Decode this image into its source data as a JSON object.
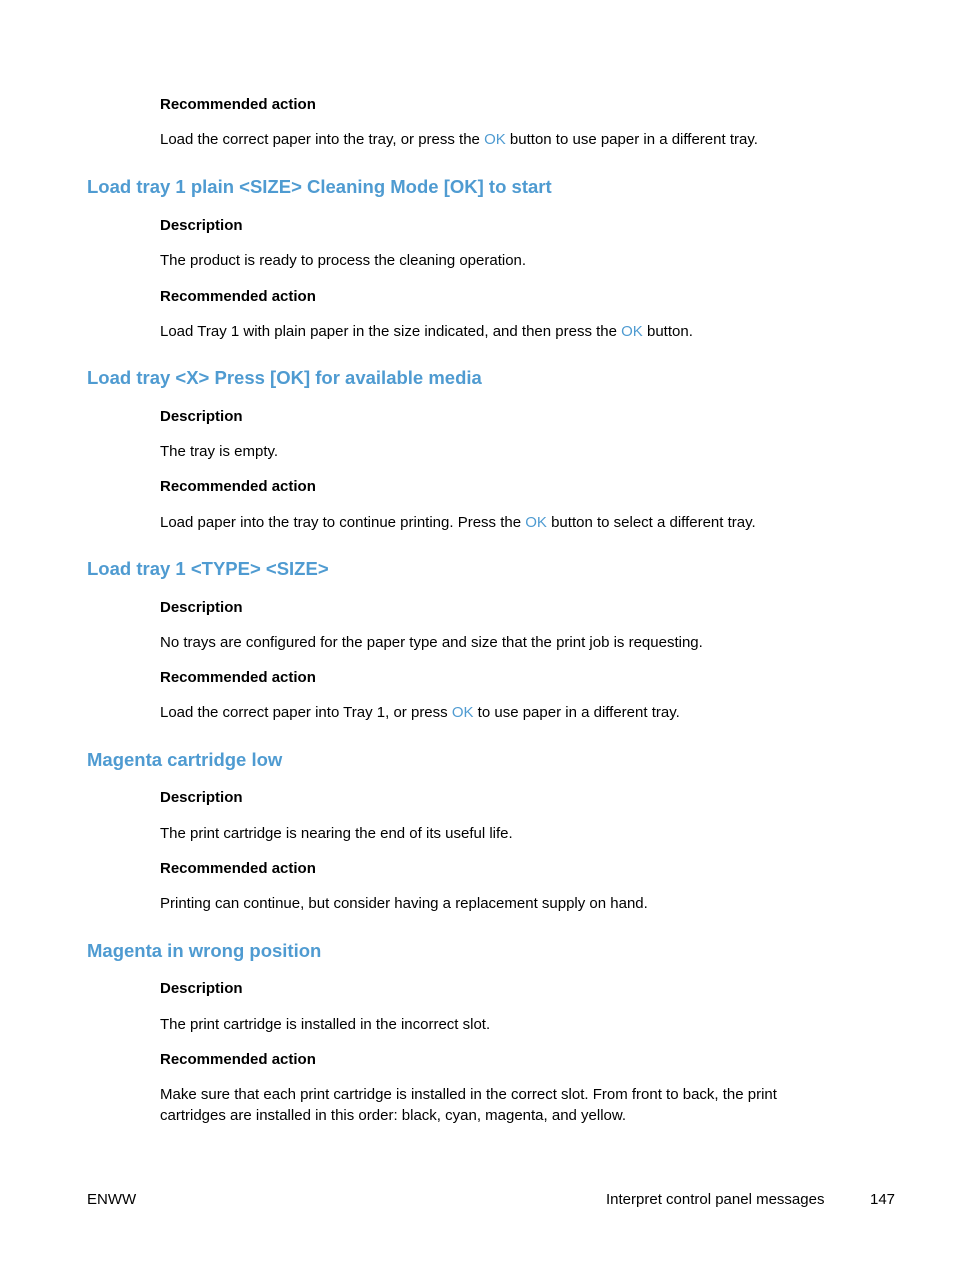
{
  "intro": {
    "label": "Recommended action",
    "text_before": "Load the correct paper into the tray, or press the ",
    "ok": "OK",
    "text_after": " button to use paper in a different tray."
  },
  "sections": [
    {
      "title": "Load tray 1 plain <SIZE> Cleaning Mode [OK] to start",
      "description_label": "Description",
      "description": "The product is ready to process the cleaning operation.",
      "action_label": "Recommended action",
      "action_before": "Load Tray 1 with plain paper in the size indicated, and then press the ",
      "action_ok": "OK",
      "action_after": " button."
    },
    {
      "title": "Load tray <X> Press [OK] for available media",
      "description_label": "Description",
      "description": "The tray is empty.",
      "action_label": "Recommended action",
      "action_before": "Load paper into the tray to continue printing. Press the ",
      "action_ok": "OK",
      "action_after": " button to select a different tray."
    },
    {
      "title": "Load tray 1 <TYPE> <SIZE>",
      "description_label": "Description",
      "description": "No trays are configured for the paper type and size that the print job is requesting.",
      "action_label": "Recommended action",
      "action_before": "Load the correct paper into Tray 1, or press ",
      "action_ok": "OK",
      "action_after": " to use paper in a different tray."
    },
    {
      "title": "Magenta cartridge low",
      "description_label": "Description",
      "description": "The print cartridge is nearing the end of its useful life.",
      "action_label": "Recommended action",
      "action_text": "Printing can continue, but consider having a replacement supply on hand."
    },
    {
      "title": "Magenta in wrong position",
      "description_label": "Description",
      "description": "The print cartridge is installed in the incorrect slot.",
      "action_label": "Recommended action",
      "action_text": "Make sure that each print cartridge is installed in the correct slot. From front to back, the print cartridges are installed in this order: black, cyan, magenta, and yellow."
    }
  ],
  "footer": {
    "left": "ENWW",
    "section": "Interpret control panel messages",
    "page_number": "147"
  }
}
